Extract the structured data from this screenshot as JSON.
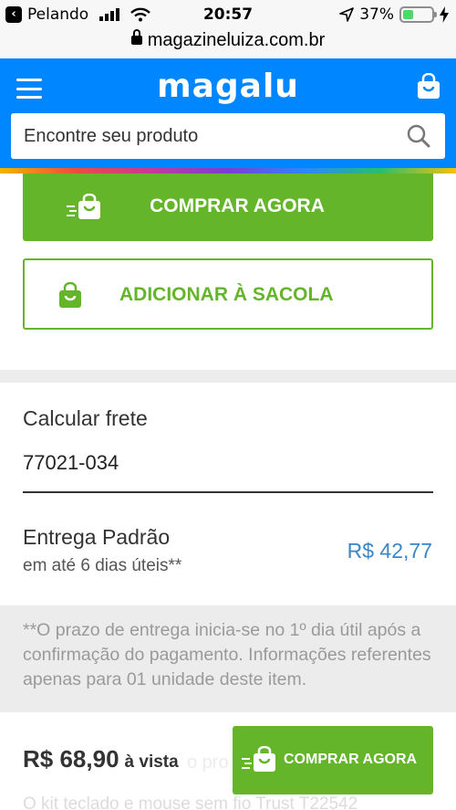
{
  "status_bar": {
    "back_label": "Pelando",
    "time": "20:57",
    "battery": "37%",
    "battery_level": 0.37
  },
  "url_bar": {
    "url": "magazineluiza.com.br"
  },
  "header": {
    "logo": "magalu",
    "search_placeholder": "Encontre seu produto"
  },
  "actions": {
    "buy_now": "COMPRAR AGORA",
    "add_to_bag": "ADICIONAR À SACOLA"
  },
  "freight": {
    "title": "Calcular frete",
    "cep": "77021-034",
    "option_name": "Entrega Padrão",
    "option_time": "em até 6 dias úteis**",
    "option_price": "R$ 42,77",
    "note": "**O prazo de entrega inicia-se no 1º dia útil após a confirmação do pagamento. Informações referentes apenas para 01 unidade deste item."
  },
  "sticky": {
    "price": "R$ 68,90",
    "price_suffix": "à vista",
    "buy_now": "COMPRAR AGORA",
    "behind_text_1": "o pro",
    "behind_text_2": "O kit teclado e mouse sem fio Trust T22542"
  },
  "colors": {
    "brand_blue": "#0086ff",
    "green": "#65b52b",
    "price_blue": "#3d86c6"
  }
}
